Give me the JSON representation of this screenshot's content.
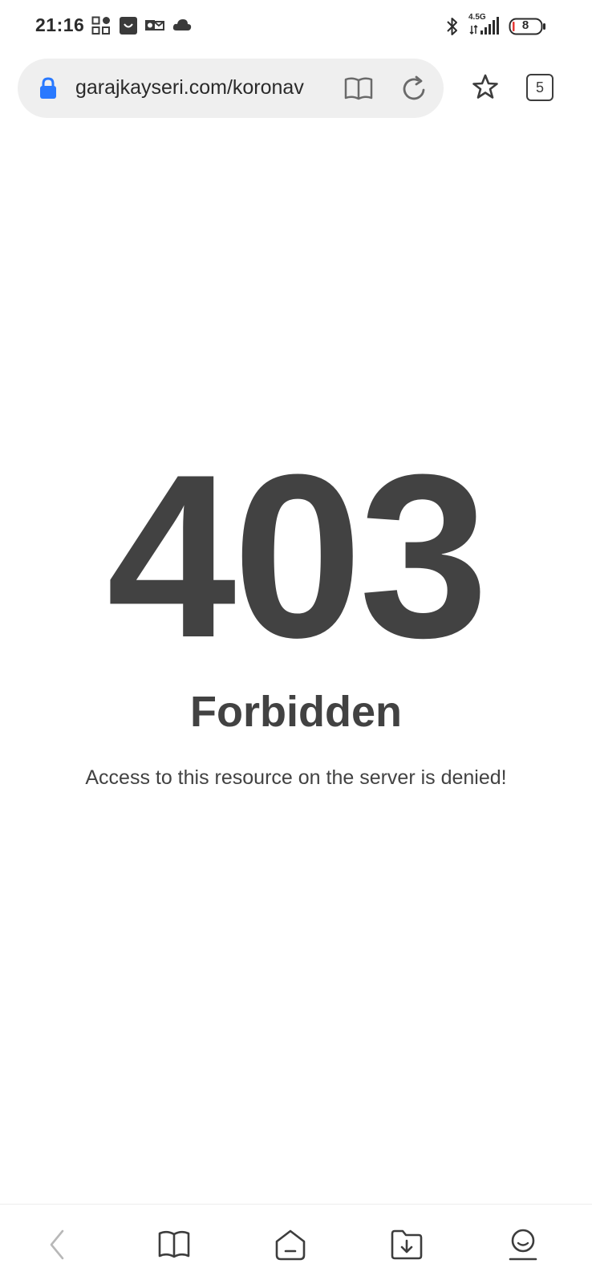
{
  "status_bar": {
    "time": "21:16",
    "network_label": "4.5G",
    "battery_level": "8",
    "icons_left": [
      "grid-apps-icon",
      "shopping-bag-icon",
      "outlook-icon",
      "cloud-icon"
    ],
    "icons_right": [
      "bluetooth-icon",
      "signal-icon",
      "battery-icon"
    ]
  },
  "browser": {
    "url": "garajkayseri.com/koronav",
    "tab_count": "5",
    "icons": [
      "lock-icon",
      "reader-mode-icon",
      "reload-icon",
      "bookmark-star-icon"
    ]
  },
  "page": {
    "code": "403",
    "title": "Forbidden",
    "message": "Access to this resource on the server is denied!"
  },
  "bottom_nav": {
    "items": [
      "back-icon",
      "bookmarks-icon",
      "home-icon",
      "downloads-icon",
      "profile-icon"
    ]
  },
  "colors": {
    "accent": "#2979ff",
    "text": "#424242",
    "pill_bg": "#efefef",
    "battery_low": "#e53935"
  }
}
